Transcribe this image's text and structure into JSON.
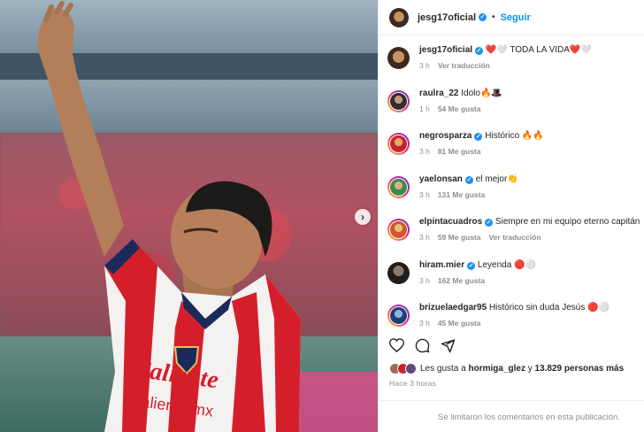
{
  "post": {
    "author": "jesg17oficial",
    "follow_label": "Seguir",
    "separator": "•",
    "carousel_next": "›"
  },
  "caption": {
    "username": "jesg17oficial",
    "text": "❤️🤍 TODA LA VIDA❤️🤍",
    "time": "3 h",
    "translate": "Ver traducción"
  },
  "comments": [
    {
      "username": "raulra_22",
      "verified": false,
      "text": "Idolo🔥🎩",
      "time": "1 h",
      "likes": "54 Me gusta",
      "translate": ""
    },
    {
      "username": "negrosparza",
      "verified": true,
      "text": "Histórico 🔥🔥",
      "time": "3 h",
      "likes": "81 Me gusta",
      "translate": ""
    },
    {
      "username": "yaelonsan",
      "verified": true,
      "text": "el mejor👏",
      "time": "3 h",
      "likes": "131 Me gusta",
      "translate": ""
    },
    {
      "username": "elpintacuadros",
      "verified": true,
      "text": "Siempre en mi equipo eterno capitán",
      "time": "3 h",
      "likes": "59 Me gusta",
      "translate": "Ver traducción"
    },
    {
      "username": "hiram.mier",
      "verified": true,
      "text": "Leyenda 🔴⚪",
      "time": "3 h",
      "likes": "162 Me gusta",
      "translate": ""
    },
    {
      "username": "brizuelaedgar95",
      "verified": false,
      "text": "Histórico sin duda Jesús 🔴⚪",
      "time": "3 h",
      "likes": "45 Me gusta",
      "translate": ""
    }
  ],
  "likes_summary": {
    "prefix": "Les gusta a",
    "user": "hormiga_glez",
    "connector": "y",
    "count": "13.829 personas más"
  },
  "posted_ago": "Hace 3 horas",
  "comments_limited": "Se limitaron los comentarios en esta publicación.",
  "colors": {
    "link_blue": "#0095f6",
    "verified_blue": "#1e90f5",
    "muted_gray": "#8e8e8e",
    "jersey_red": "#d41f2b"
  },
  "icons": [
    "heart-icon",
    "comment-icon",
    "share-icon",
    "verified-icon",
    "chevron-right-icon"
  ]
}
